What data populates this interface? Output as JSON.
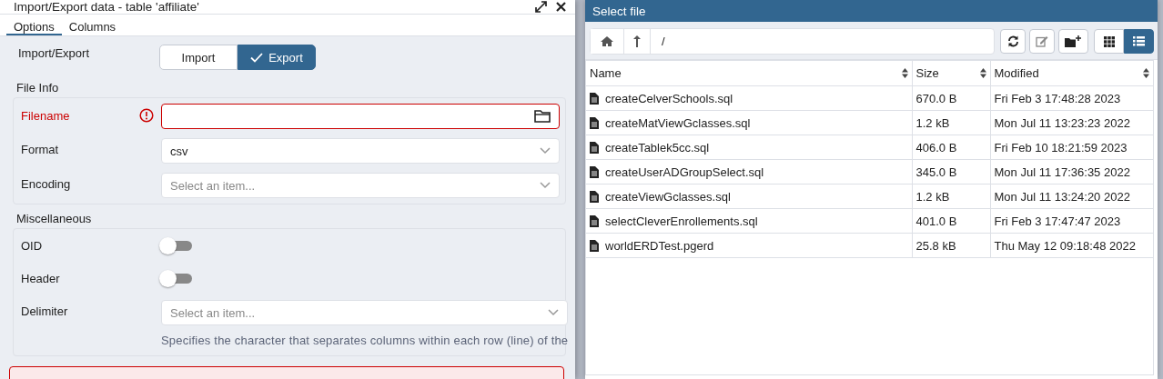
{
  "export_dialog": {
    "title": "Import/Export data - table 'affiliate'",
    "tabs": [
      {
        "label": "Options",
        "selected": true
      },
      {
        "label": "Columns",
        "selected": false
      }
    ],
    "import_export": {
      "label": "Import/Export",
      "options": [
        {
          "label": "Import",
          "selected": false
        },
        {
          "label": "Export",
          "selected": true
        }
      ]
    },
    "file_info": {
      "title": "File Info",
      "fields": [
        {
          "kind": "file",
          "label": "Filename",
          "invalid": true
        },
        {
          "kind": "select",
          "label": "Format",
          "value": "csv"
        },
        {
          "kind": "select",
          "label": "Encoding",
          "placeholder": "Select an item..."
        }
      ]
    },
    "miscellaneous": {
      "title": "Miscellaneous",
      "fields": [
        {
          "kind": "switch",
          "label": "OID",
          "on": false
        },
        {
          "kind": "switch",
          "label": "Header",
          "on": false
        },
        {
          "kind": "select",
          "label": "Delimiter",
          "placeholder": "Select an item...",
          "help": "Specifies the character that separates columns within each row (line) of the"
        }
      ]
    }
  },
  "file_dialog": {
    "title": "Select file",
    "path": "/",
    "view_buttons": [
      {
        "kind": "grid",
        "selected": false
      },
      {
        "kind": "list",
        "selected": true
      }
    ],
    "columns": [
      "Name",
      "Size",
      "Modified"
    ],
    "rows": [
      {
        "name": "createCelverSchools.sql",
        "size": "670.0 B",
        "modified": "Fri Feb 3 17:48:28 2023"
      },
      {
        "name": "createMatViewGclasses.sql",
        "size": "1.2 kB",
        "modified": "Mon Jul 11 13:23:23 2022"
      },
      {
        "name": "createTablek5cc.sql",
        "size": "406.0 B",
        "modified": "Fri Feb 10 18:21:59 2023"
      },
      {
        "name": "createUserADGroupSelect.sql",
        "size": "345.0 B",
        "modified": "Mon Jul 11 17:36:35 2022"
      },
      {
        "name": "createViewGclasses.sql",
        "size": "1.2 kB",
        "modified": "Mon Jul 11 13:24:20 2022"
      },
      {
        "name": "selectCleverEnrollements.sql",
        "size": "401.0 B",
        "modified": "Fri Feb 3 17:47:47 2023"
      },
      {
        "name": "worldERDTest.pgerd",
        "size": "25.8 kB",
        "modified": "Thu May 12 09:18:48 2022"
      }
    ]
  }
}
